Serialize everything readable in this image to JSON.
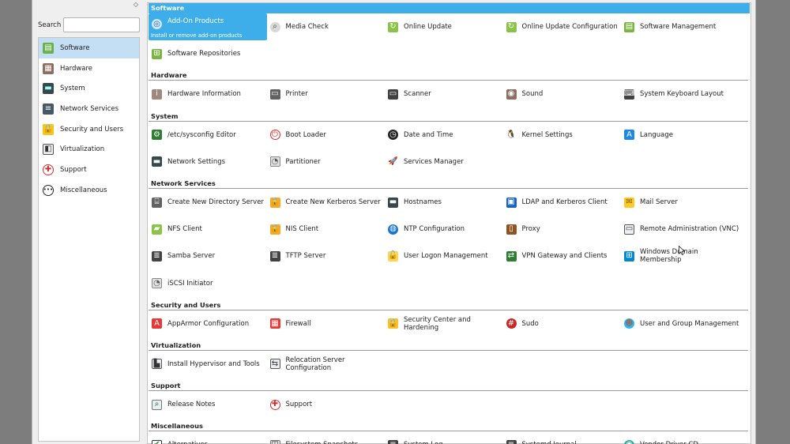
{
  "sidebar": {
    "pin_glyph": "◇",
    "search_label": "Search",
    "search_value": "",
    "items": [
      {
        "label": "Software",
        "icon": "software-icon",
        "active": true
      },
      {
        "label": "Hardware",
        "icon": "hardware-icon"
      },
      {
        "label": "System",
        "icon": "system-icon"
      },
      {
        "label": "Network Services",
        "icon": "network-services-icon"
      },
      {
        "label": "Security and Users",
        "icon": "security-icon"
      },
      {
        "label": "Virtualization",
        "icon": "virtualization-icon"
      },
      {
        "label": "Support",
        "icon": "support-icon"
      },
      {
        "label": "Miscellaneous",
        "icon": "miscellaneous-icon"
      }
    ]
  },
  "sections": [
    {
      "title": "Software",
      "modules": [
        {
          "label": "Add-On Products",
          "icon": "addon-disc-icon",
          "selected": true,
          "description": "Install or remove add-on products"
        },
        {
          "label": "Media Check",
          "icon": "media-check-icon"
        },
        {
          "label": "Online Update",
          "icon": "online-update-icon"
        },
        {
          "label": "Online Update Configuration",
          "icon": "online-update-config-icon"
        },
        {
          "label": "Software Management",
          "icon": "software-management-icon"
        },
        {
          "label": "Software Repositories",
          "icon": "software-repositories-icon"
        }
      ]
    },
    {
      "title": "Hardware",
      "modules": [
        {
          "label": "Hardware Information",
          "icon": "hardware-info-icon"
        },
        {
          "label": "Printer",
          "icon": "printer-icon"
        },
        {
          "label": "Scanner",
          "icon": "scanner-icon"
        },
        {
          "label": "Sound",
          "icon": "sound-icon"
        },
        {
          "label": "System Keyboard Layout",
          "icon": "keyboard-icon"
        }
      ]
    },
    {
      "title": "System",
      "modules": [
        {
          "label": "/etc/sysconfig Editor",
          "icon": "sysconfig-editor-icon"
        },
        {
          "label": "Boot Loader",
          "icon": "boot-loader-icon"
        },
        {
          "label": "Date and Time",
          "icon": "clock-icon"
        },
        {
          "label": "Kernel Settings",
          "icon": "penguin-icon"
        },
        {
          "label": "Language",
          "icon": "language-icon"
        },
        {
          "label": "Network Settings",
          "icon": "network-settings-icon"
        },
        {
          "label": "Partitioner",
          "icon": "partitioner-icon"
        },
        {
          "label": "Services Manager",
          "icon": "services-manager-icon"
        }
      ]
    },
    {
      "title": "Network Services",
      "modules": [
        {
          "label": "Create New Directory Server",
          "icon": "directory-server-icon"
        },
        {
          "label": "Create New Kerberos Server",
          "icon": "kerberos-lock-icon"
        },
        {
          "label": "Hostnames",
          "icon": "hostnames-icon"
        },
        {
          "label": "LDAP and Kerberos Client",
          "icon": "ldap-client-icon"
        },
        {
          "label": "Mail Server",
          "icon": "mail-icon"
        },
        {
          "label": "NFS Client",
          "icon": "nfs-folder-icon"
        },
        {
          "label": "NIS Client",
          "icon": "nis-lock-icon"
        },
        {
          "label": "NTP Configuration",
          "icon": "globe-icon"
        },
        {
          "label": "Proxy",
          "icon": "proxy-door-icon"
        },
        {
          "label": "Remote Administration (VNC)",
          "icon": "remote-admin-icon"
        },
        {
          "label": "Samba Server",
          "icon": "samba-server-icon"
        },
        {
          "label": "TFTP Server",
          "icon": "tftp-server-icon"
        },
        {
          "label": "User Logon Management",
          "icon": "user-logon-lock-icon"
        },
        {
          "label": "VPN Gateway and Clients",
          "icon": "vpn-icon"
        },
        {
          "label": "Windows Domain Membership",
          "icon": "windows-domain-icon"
        },
        {
          "label": "iSCSI Initiator",
          "icon": "iscsi-icon"
        }
      ]
    },
    {
      "title": "Security and Users",
      "modules": [
        {
          "label": "AppArmor Configuration",
          "icon": "apparmor-icon"
        },
        {
          "label": "Firewall",
          "icon": "firewall-icon"
        },
        {
          "label": "Security Center and Hardening",
          "icon": "security-lock-icon"
        },
        {
          "label": "Sudo",
          "icon": "sudo-icon"
        },
        {
          "label": "User and Group Management",
          "icon": "user-group-icon"
        }
      ]
    },
    {
      "title": "Virtualization",
      "modules": [
        {
          "label": "Install Hypervisor and Tools",
          "icon": "hypervisor-icon"
        },
        {
          "label": "Relocation Server Configuration",
          "icon": "relocation-server-icon"
        }
      ]
    },
    {
      "title": "Support",
      "modules": [
        {
          "label": "Release Notes",
          "icon": "release-notes-icon"
        },
        {
          "label": "Support",
          "icon": "lifebuoy-icon"
        }
      ]
    },
    {
      "title": "Miscellaneous",
      "modules": [
        {
          "label": "Alternatives",
          "icon": "alternatives-check-icon"
        },
        {
          "label": "Filesystem Snapshots",
          "icon": "snapshots-icon"
        },
        {
          "label": "System Log",
          "icon": "system-log-icon"
        },
        {
          "label": "Systemd Journal",
          "icon": "journal-icon"
        },
        {
          "label": "Vendor Driver CD",
          "icon": "vendor-driver-cd-icon"
        }
      ]
    }
  ],
  "colors": {
    "accent": "#3daee9",
    "sidebar_active": "#c4def4"
  }
}
